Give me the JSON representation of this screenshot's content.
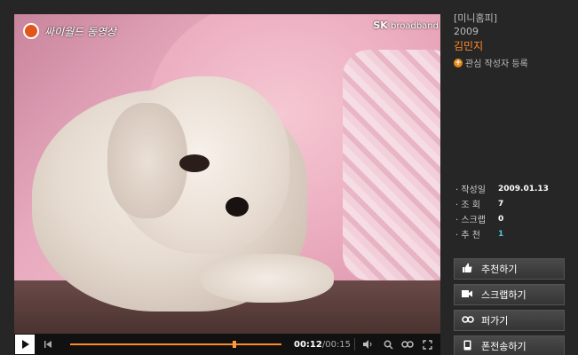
{
  "video": {
    "logo_left": "싸이월드 동영상",
    "logo_right_brand": "SK",
    "logo_right_sub": "broadband"
  },
  "player": {
    "current_time": "00:12",
    "total_time": "/00:15",
    "progress": 0.8,
    "icons": [
      "play-icon",
      "previous-icon",
      "volume-icon",
      "search-icon",
      "loop-icon",
      "fullscreen-icon"
    ]
  },
  "side": {
    "category": "[미니홈피]",
    "year": "2009",
    "author": "김민지",
    "follow_label": "관심 작성자 등록"
  },
  "meta": [
    {
      "key": "· 작성일",
      "value": "2009.01.13"
    },
    {
      "key": "· 조  회",
      "value": "7"
    },
    {
      "key": "· 스크랩",
      "value": "0"
    },
    {
      "key": "· 추  천",
      "value": "1"
    }
  ],
  "actions": [
    {
      "label": "추천하기",
      "icon": "thumbs-up-icon"
    },
    {
      "label": "스크랩하기",
      "icon": "scrap-icon"
    },
    {
      "label": "퍼가기",
      "icon": "link-icon"
    },
    {
      "label": "폰전송하기",
      "icon": "phone-icon"
    }
  ],
  "colors": {
    "accent": "#ff8a2a",
    "background": "#262626",
    "highlight": "#4fc7e0"
  }
}
